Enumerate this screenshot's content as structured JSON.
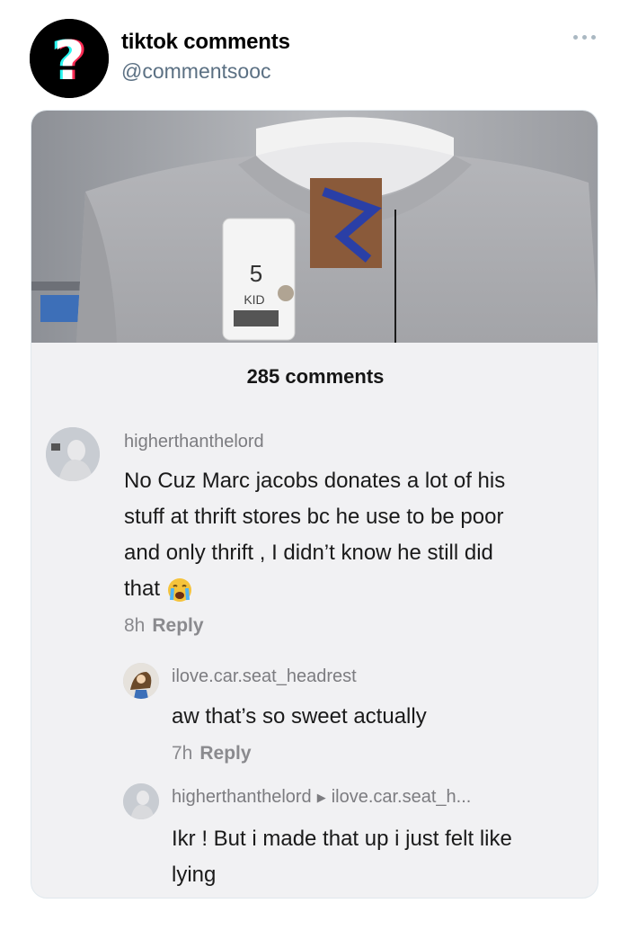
{
  "tweet": {
    "display_name": "tiktok comments",
    "handle": "@commentsooc",
    "avatar_icon": "question-mark-icon"
  },
  "media": {
    "photo_tag_text": "KID",
    "photo_price": "5",
    "comment_count": "285 comments",
    "comments": [
      {
        "username": "higherthanthelord",
        "text": "No Cuz Marc jacobs donates a lot of his stuff at thrift stores bc he use to be poor and only thrift , I didn’t know he still did that",
        "line1": "No Cuz Marc jacobs donates a lot of his",
        "line2": "stuff at thrift stores bc he use to be poor",
        "line3": "and only thrift , I didn’t know he still did",
        "line4": "that",
        "emoji": "crying-face-icon",
        "time": "8h",
        "reply_label": "Reply"
      },
      {
        "username": "ilove.car.seat_headrest",
        "text": "aw that’s so sweet actually",
        "time": "7h",
        "reply_label": "Reply"
      },
      {
        "username": "higherthanthelord",
        "reply_to": "ilove.car.seat_h...",
        "line1": "Ikr ! But i made that up i just felt like",
        "line2": "lying"
      }
    ]
  },
  "colors": {
    "handle": "#5b7083",
    "card_bg": "#f1f1f3",
    "muted": "#8a8a8e"
  }
}
